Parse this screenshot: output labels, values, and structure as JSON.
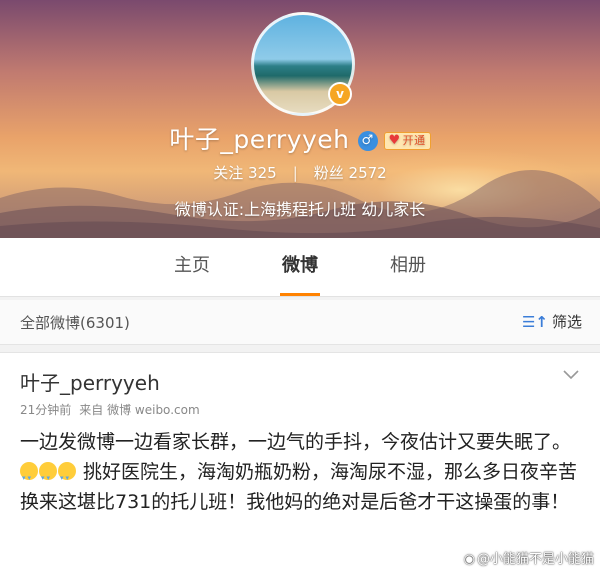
{
  "profile": {
    "nickname": "叶子_perryyeh",
    "gender_symbol": "♂",
    "vip_label": "开通",
    "follow_label": "关注",
    "follow_count": "325",
    "fans_label": "粉丝",
    "fans_count": "2572",
    "verify_text": "微博认证:上海携程托儿班 幼儿家长"
  },
  "tabs": [
    {
      "label": "主页"
    },
    {
      "label": "微博"
    },
    {
      "label": "相册"
    }
  ],
  "filter": {
    "all_label": "全部微博(6301)",
    "filter_label": "筛选"
  },
  "post": {
    "author": "叶子_perryyeh",
    "time": "21分钟前",
    "source": "来自 微博 weibo.com",
    "text_part1": "一边发微博一边看家长群，一边气的手抖，今夜估计又要失眠了。",
    "text_part2": "挑好医院生，海淘奶瓶奶粉，海淘尿不湿，那么多日夜辛苦换来这堪比731的托儿班！我他妈的绝对是后爸才干这操蛋的事！"
  },
  "watermark": "@小能猫不是小能猫",
  "colors": {
    "accent": "#ff8200",
    "link": "#3b7dd8"
  },
  "icons": [
    "verified-badge-icon",
    "male-gender-icon",
    "vip-crown-icon",
    "filter-icon",
    "chevron-down-icon",
    "crying-emoji-icon",
    "weibo-logo-icon"
  ]
}
